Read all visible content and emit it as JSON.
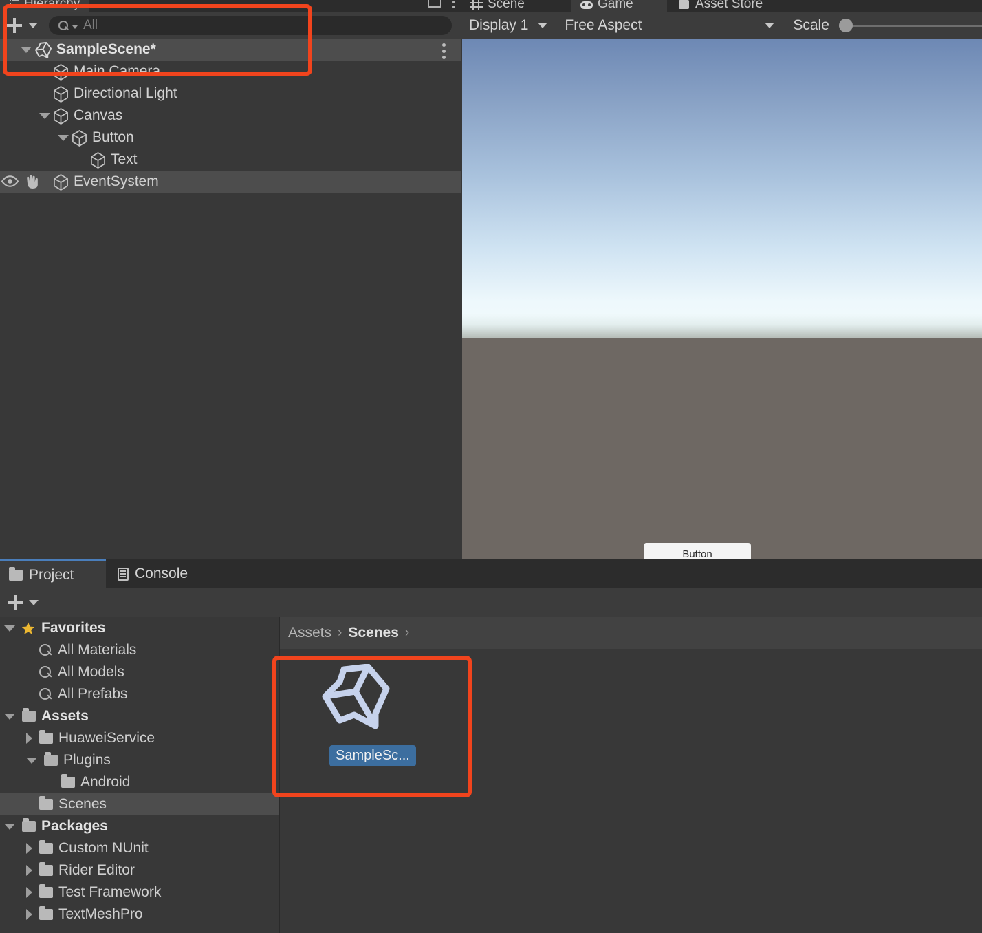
{
  "app": "Unity Editor",
  "hierarchy": {
    "tab_label": "Hierarchy",
    "tab_icon": "hierarchy-icon",
    "add_button_label": "+",
    "search": {
      "placeholder": "All",
      "value": "",
      "icon": "search-icon"
    },
    "window_menu_icon": "kebab-icon",
    "maximize_icon": "maximize-icon",
    "rows": [
      {
        "label": "SampleScene*",
        "icon": "unity-scene-icon",
        "indent": 0,
        "twisty": "down",
        "selected": true,
        "bold": true,
        "kebab": true
      },
      {
        "label": "Main Camera",
        "icon": "gameobject-cube-icon",
        "indent": 1,
        "twisty": "none",
        "selected": false,
        "bold": false,
        "kebab": false
      },
      {
        "label": "Directional Light",
        "icon": "gameobject-cube-icon",
        "indent": 1,
        "twisty": "none",
        "selected": false,
        "bold": false,
        "kebab": false
      },
      {
        "label": "Canvas",
        "icon": "gameobject-cube-icon",
        "indent": 1,
        "twisty": "down",
        "selected": false,
        "bold": false,
        "kebab": false
      },
      {
        "label": "Button",
        "icon": "gameobject-cube-icon",
        "indent": 2,
        "twisty": "down",
        "selected": false,
        "bold": false,
        "kebab": false
      },
      {
        "label": "Text",
        "icon": "gameobject-cube-icon",
        "indent": 3,
        "twisty": "none",
        "selected": false,
        "bold": false,
        "kebab": false
      },
      {
        "label": "EventSystem",
        "icon": "gameobject-cube-icon",
        "indent": 1,
        "twisty": "none",
        "selected": true,
        "bold": false,
        "kebab": false,
        "eye": true,
        "hand": true
      }
    ]
  },
  "game_view": {
    "tabs": [
      {
        "label": "Scene",
        "icon": "scene-grid-icon",
        "active": false
      },
      {
        "label": "Game",
        "icon": "game-pad-icon",
        "active": true
      },
      {
        "label": "Asset Store",
        "icon": "asset-store-icon",
        "active": false
      }
    ],
    "display_dropdown": "Display 1",
    "aspect_dropdown": "Free Aspect",
    "scale_label": "Scale",
    "scale_value": 1,
    "button_label": "Button",
    "sky_top_color": "#6d88b4",
    "sky_horizon_color": "#f2fbfb",
    "ground_color": "#6e6863"
  },
  "project": {
    "tabs": [
      {
        "label": "Project",
        "icon": "folder-icon",
        "active": true
      },
      {
        "label": "Console",
        "icon": "console-icon",
        "active": false
      }
    ],
    "add_button_label": "+",
    "breadcrumb": [
      {
        "label": "Assets",
        "bold": false
      },
      {
        "label": "Scenes",
        "bold": true
      }
    ],
    "breadcrumb_separator": "›",
    "tree": [
      {
        "label": "Favorites",
        "icon": "star-icon",
        "indent": 0,
        "twisty": "down",
        "bold": true,
        "selected": false
      },
      {
        "label": "All Materials",
        "icon": "search-icon",
        "indent": 1,
        "twisty": "none",
        "bold": false,
        "selected": false
      },
      {
        "label": "All Models",
        "icon": "search-icon",
        "indent": 1,
        "twisty": "none",
        "bold": false,
        "selected": false
      },
      {
        "label": "All Prefabs",
        "icon": "search-icon",
        "indent": 1,
        "twisty": "none",
        "bold": false,
        "selected": false
      },
      {
        "label": "Assets",
        "icon": "folder-open-icon",
        "indent": 0,
        "twisty": "down",
        "bold": true,
        "selected": false
      },
      {
        "label": "HuaweiService",
        "icon": "folder-icon",
        "indent": 1,
        "twisty": "right",
        "bold": false,
        "selected": false
      },
      {
        "label": "Plugins",
        "icon": "folder-open-icon",
        "indent": 1,
        "twisty": "down",
        "bold": false,
        "selected": false
      },
      {
        "label": "Android",
        "icon": "folder-icon",
        "indent": 2,
        "twisty": "none",
        "bold": false,
        "selected": false
      },
      {
        "label": "Scenes",
        "icon": "folder-icon",
        "indent": 1,
        "twisty": "none",
        "bold": false,
        "selected": true
      },
      {
        "label": "Packages",
        "icon": "folder-open-icon",
        "indent": 0,
        "twisty": "down",
        "bold": true,
        "selected": false
      },
      {
        "label": "Custom NUnit",
        "icon": "folder-icon",
        "indent": 1,
        "twisty": "right",
        "bold": false,
        "selected": false
      },
      {
        "label": "Rider Editor",
        "icon": "folder-icon",
        "indent": 1,
        "twisty": "right",
        "bold": false,
        "selected": false
      },
      {
        "label": "Test Framework",
        "icon": "folder-icon",
        "indent": 1,
        "twisty": "right",
        "bold": false,
        "selected": false
      },
      {
        "label": "TextMeshPro",
        "icon": "folder-icon",
        "indent": 1,
        "twisty": "right",
        "bold": false,
        "selected": false
      }
    ],
    "assets": [
      {
        "label": "SampleSc...",
        "icon": "unity-scene-asset-icon",
        "selected": true
      }
    ]
  },
  "annotations": {
    "color": "#f1441d",
    "boxes": [
      {
        "name": "hierarchy-scene-highlight"
      },
      {
        "name": "scene-asset-highlight"
      }
    ]
  }
}
